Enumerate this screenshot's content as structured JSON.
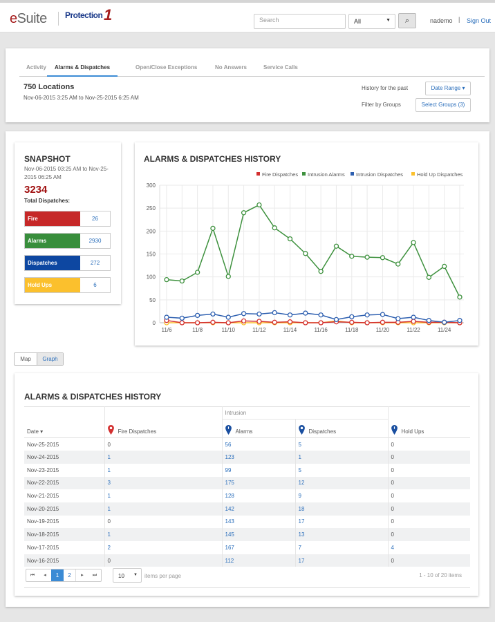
{
  "header": {
    "brand": "eSuite",
    "partner": "Protection",
    "partner_mark": "1",
    "search_placeholder": "Search",
    "scope": "All",
    "user": "nademo",
    "signout": "Sign Out"
  },
  "tabs": [
    "Activity",
    "Alarms & Dispatches",
    "Open/Close Exceptions",
    "No Answers",
    "Service Calls"
  ],
  "summary": {
    "title": "750 Locations",
    "range": "Nov-06-2015 3:25 AM to Nov-25-2015 6:25 AM",
    "history_label": "History for the past",
    "date_range_btn": "Date Range ▾",
    "filter_label": "Filter by Groups",
    "groups_btn": "Select Groups (3)"
  },
  "snapshot": {
    "title": "SNAPSHOT",
    "range": "Nov-06-2015 03:25 AM to Nov-25-2015 06:25 AM",
    "total": "3234",
    "total_label": "Total Dispatches:",
    "items": [
      {
        "label": "Fire",
        "value": "26",
        "color": "#c62828"
      },
      {
        "label": "Alarms",
        "value": "2930",
        "color": "#388e3c"
      },
      {
        "label": "Dispatches",
        "value": "272",
        "color": "#0d47a1"
      },
      {
        "label": "Hold Ups",
        "value": "6",
        "color": "#fbc02d"
      }
    ]
  },
  "view_toggle": {
    "map": "Map",
    "graph": "Graph"
  },
  "chart_data": {
    "type": "line",
    "title": "ALARMS & DISPATCHES HISTORY",
    "legend_position": "top-right",
    "grid": true,
    "ylim": [
      0,
      300
    ],
    "yticks": [
      0,
      50,
      100,
      150,
      200,
      250,
      300
    ],
    "x": [
      "11/6",
      "11/7",
      "11/8",
      "11/9",
      "11/10",
      "11/11",
      "11/12",
      "11/13",
      "11/14",
      "11/15",
      "11/16",
      "11/17",
      "11/18",
      "11/19",
      "11/20",
      "11/21",
      "11/22",
      "11/23",
      "11/24",
      "11/25"
    ],
    "xtick_labels": [
      "11/6",
      "11/8",
      "11/10",
      "11/12",
      "11/14",
      "11/16",
      "11/18",
      "11/20",
      "11/22",
      "11/24"
    ],
    "series": [
      {
        "name": "Fire Dispatches",
        "color": "#d32f2f",
        "values": [
          5,
          0,
          0,
          1,
          0,
          4,
          3,
          1,
          2,
          0,
          0,
          2,
          1,
          0,
          1,
          1,
          3,
          1,
          1,
          0
        ]
      },
      {
        "name": "Intrusion Alarms",
        "color": "#3e913e",
        "values": [
          94,
          91,
          110,
          206,
          101,
          240,
          257,
          207,
          183,
          151,
          112,
          167,
          145,
          143,
          142,
          128,
          175,
          99,
          123,
          56
        ]
      },
      {
        "name": "Intrusion Dispatches",
        "color": "#2d5fb0",
        "values": [
          12,
          10,
          16,
          19,
          12,
          20,
          19,
          22,
          17,
          21,
          17,
          7,
          13,
          17,
          18,
          9,
          12,
          5,
          1,
          5
        ]
      },
      {
        "name": "Hold Up Dispatches",
        "color": "#fbc02d",
        "values": [
          0,
          0,
          0,
          0,
          0,
          0,
          0,
          0,
          0,
          0,
          0,
          4,
          0,
          0,
          0,
          0,
          0,
          0,
          0,
          0
        ]
      }
    ]
  },
  "table": {
    "title": "ALARMS & DISPATCHES HISTORY",
    "group": "Intrusion",
    "headers": [
      "Date ▾",
      "Fire Dispatches",
      "Alarms",
      "Dispatches",
      "Hold Ups"
    ],
    "rows": [
      [
        "Nov-25-2015",
        "0",
        "56",
        "5",
        "0"
      ],
      [
        "Nov-24-2015",
        "1",
        "123",
        "1",
        "0"
      ],
      [
        "Nov-23-2015",
        "1",
        "99",
        "5",
        "0"
      ],
      [
        "Nov-22-2015",
        "3",
        "175",
        "12",
        "0"
      ],
      [
        "Nov-21-2015",
        "1",
        "128",
        "9",
        "0"
      ],
      [
        "Nov-20-2015",
        "1",
        "142",
        "18",
        "0"
      ],
      [
        "Nov-19-2015",
        "0",
        "143",
        "17",
        "0"
      ],
      [
        "Nov-18-2015",
        "1",
        "145",
        "13",
        "0"
      ],
      [
        "Nov-17-2015",
        "2",
        "167",
        "7",
        "4"
      ],
      [
        "Nov-16-2015",
        "0",
        "112",
        "17",
        "0"
      ]
    ],
    "pager": {
      "first": "⏮",
      "prev": "◂",
      "pages": [
        "1",
        "2"
      ],
      "current": "1",
      "next": "▸",
      "last": "⏭",
      "per_page": "10",
      "per_page_label": "items per page",
      "info": "1 - 10 of 20 items"
    }
  }
}
